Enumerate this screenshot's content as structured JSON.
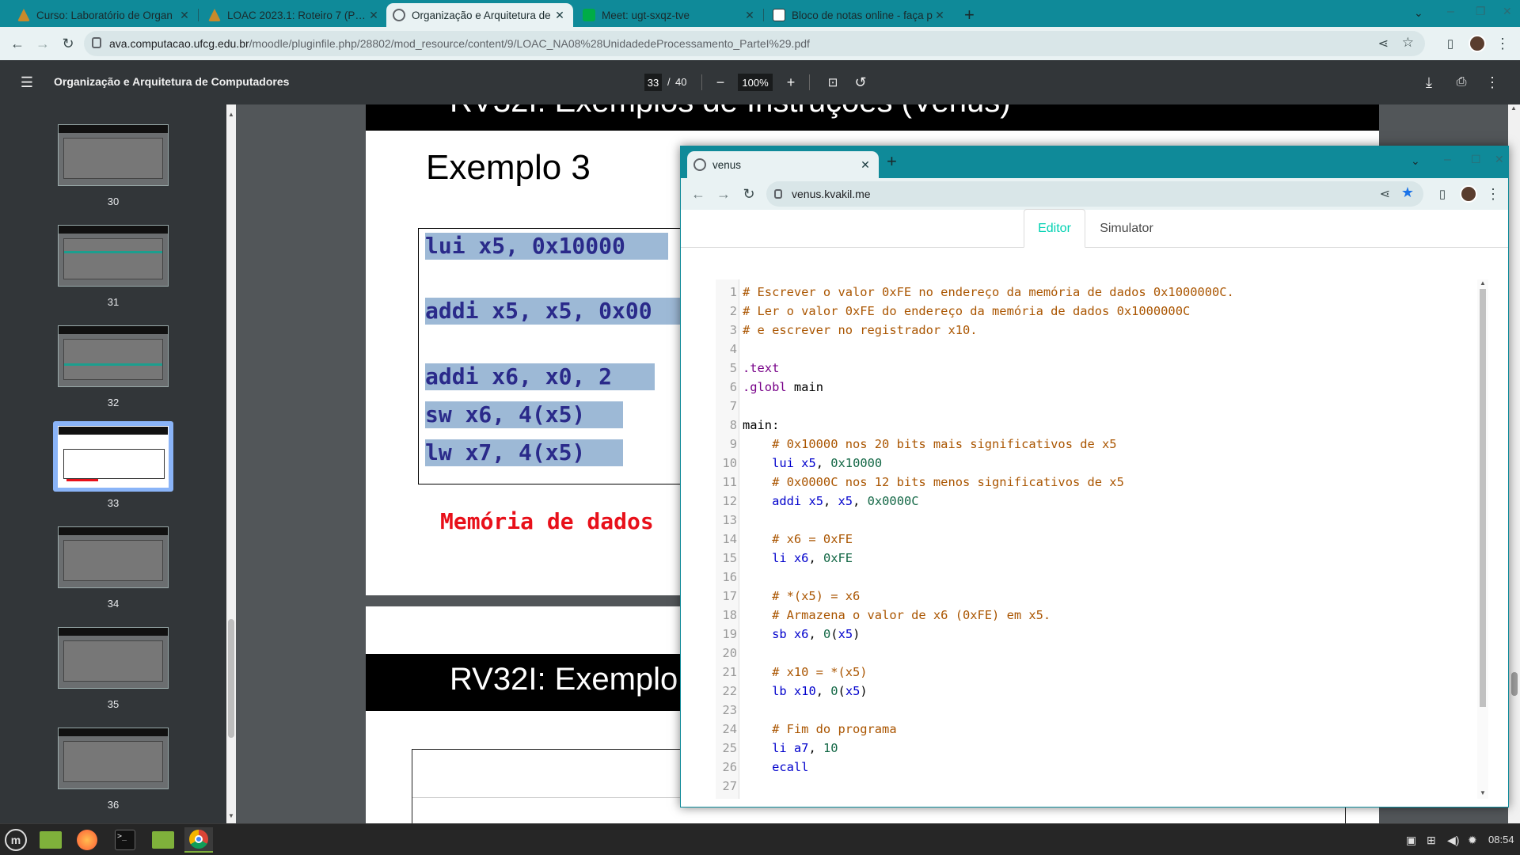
{
  "browser": {
    "tabs": [
      {
        "title": "Curso: Laboratório de Organ",
        "favicon_color": "#c98a2a",
        "active": false
      },
      {
        "title": "LOAC 2023.1: Roteiro 7 (Parte",
        "favicon_color": "#c98a2a",
        "active": false
      },
      {
        "title": "Organização e Arquitetura de",
        "favicon_color": "#5f6368",
        "active": true
      },
      {
        "title": "Meet: ugt-sxqz-tve",
        "favicon_color": "#00ac47",
        "active": false
      },
      {
        "title": "Bloco de notas online - faça p",
        "favicon_color": "#ffffff",
        "active": false
      }
    ],
    "new_tab": "+",
    "url_host": "ava.computacao.ufcg.edu.br",
    "url_path": "/moodle/pluginfile.php/28802/mod_resource/content/9/LOAC_NA08%28UnidadedeProcessamento_ParteI%29.pdf"
  },
  "pdf_viewer": {
    "title": "Organização e Arquitetura de Computadores",
    "current_page": "33",
    "page_separator": "/",
    "total_pages": "40",
    "zoom": "100%",
    "thumbnails": [
      "30",
      "31",
      "32",
      "33",
      "34",
      "35",
      "36"
    ],
    "selected_thumbnail": "33"
  },
  "slide": {
    "top_title_partial": "RV32I: Exemplos de Instruções (Venus)",
    "example_title": "Exemplo 3",
    "code_lines": [
      "lui x5, 0x10000",
      "addi x5, x5, 0x00",
      "addi x6, x0, 2",
      "sw x6, 4(x5)",
      "lw x7, 4(x5)"
    ],
    "memory_label": "Memória de dados",
    "next_slide_title": "RV32I: Exemplo"
  },
  "venus_window": {
    "tab_title": "venus",
    "url": "venus.kvakil.me",
    "tabs": [
      "Editor",
      "Simulator"
    ],
    "active_tab": "Editor",
    "code": [
      {
        "n": "1",
        "text": "# Escrever o valor 0xFE no endereço da memória de dados 0x1000000C.",
        "kind": "com"
      },
      {
        "n": "2",
        "text": "# Ler o valor 0xFE do endereço da memória de dados 0x1000000C",
        "kind": "com"
      },
      {
        "n": "3",
        "text": "# e escrever no registrador x10.",
        "kind": "com"
      },
      {
        "n": "4",
        "text": "",
        "kind": "txt"
      },
      {
        "n": "5",
        "text": ".text",
        "kind": "dir"
      },
      {
        "n": "6",
        "text": ".globl main",
        "kind": "globl"
      },
      {
        "n": "7",
        "text": "",
        "kind": "txt"
      },
      {
        "n": "8",
        "text": "main:",
        "kind": "txt"
      },
      {
        "n": "9",
        "text": "    # 0x10000 nos 20 bits mais significativos de x5",
        "kind": "com"
      },
      {
        "n": "10",
        "text": "    lui x5, 0x10000",
        "kind": "ins"
      },
      {
        "n": "11",
        "text": "    # 0x0000C nos 12 bits menos significativos de x5",
        "kind": "com"
      },
      {
        "n": "12",
        "text": "    addi x5, x5, 0x0000C",
        "kind": "ins"
      },
      {
        "n": "13",
        "text": "",
        "kind": "txt"
      },
      {
        "n": "14",
        "text": "    # x6 = 0xFE",
        "kind": "com"
      },
      {
        "n": "15",
        "text": "    li x6, 0xFE",
        "kind": "ins"
      },
      {
        "n": "16",
        "text": "",
        "kind": "txt"
      },
      {
        "n": "17",
        "text": "    # *(x5) = x6",
        "kind": "com"
      },
      {
        "n": "18",
        "text": "    # Armazena o valor de x6 (0xFE) em x5.",
        "kind": "com"
      },
      {
        "n": "19",
        "text": "    sb x6, 0(x5)",
        "kind": "ins"
      },
      {
        "n": "20",
        "text": "",
        "kind": "txt"
      },
      {
        "n": "21",
        "text": "    # x10 = *(x5)",
        "kind": "com"
      },
      {
        "n": "22",
        "text": "    lb x10, 0(x5)",
        "kind": "ins"
      },
      {
        "n": "23",
        "text": "",
        "kind": "txt"
      },
      {
        "n": "24",
        "text": "    # Fim do programa",
        "kind": "com"
      },
      {
        "n": "25",
        "text": "    li a7, 10",
        "kind": "ins"
      },
      {
        "n": "26",
        "text": "    ecall",
        "kind": "ins"
      },
      {
        "n": "27",
        "text": "",
        "kind": "txt"
      }
    ]
  },
  "taskbar": {
    "clock": "08:54",
    "apps": [
      "menu-icon",
      "files-icon",
      "firefox-icon",
      "terminal-icon",
      "folder-icon",
      "chrome-icon"
    ]
  },
  "colors": {
    "chrome_teal": "#0f8a99",
    "venus_accent": "#00d1b2",
    "memory_red": "#e8101a"
  }
}
